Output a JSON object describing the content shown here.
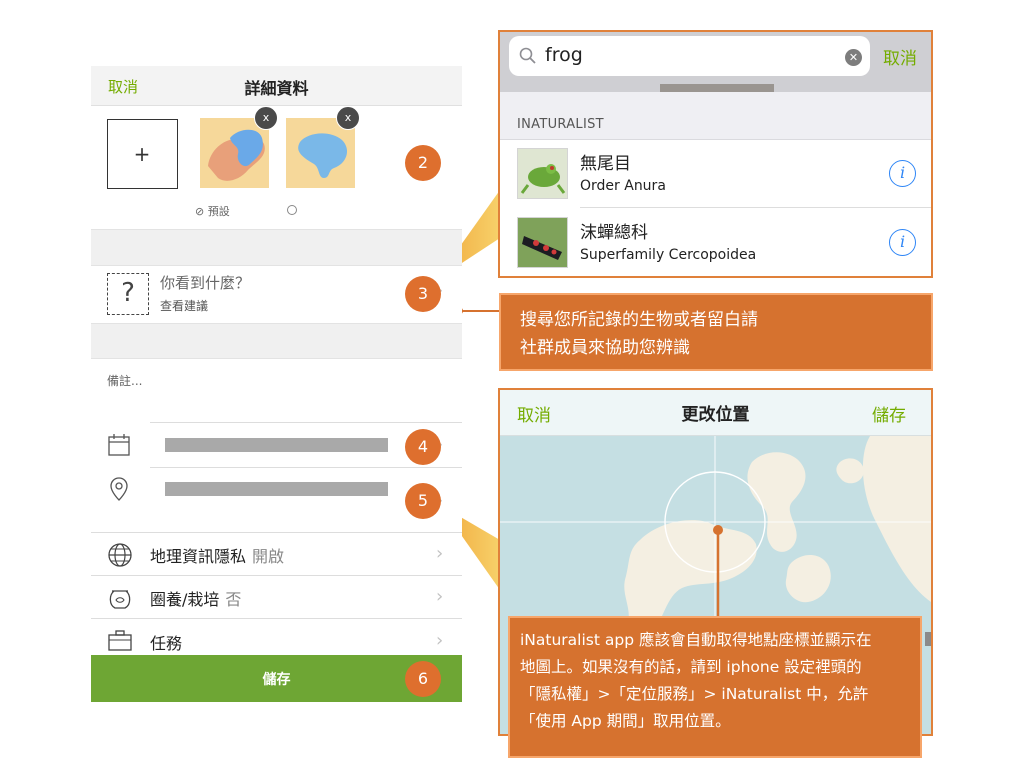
{
  "phone": {
    "header": {
      "cancel": "取消",
      "title": "詳細資料"
    },
    "add_photo": "+",
    "photo_remove": "x",
    "default_label": "⊘ 預設",
    "identify": {
      "title": "你看到什麼？",
      "subtitle": "查看建議",
      "icon": "?"
    },
    "notes_placeholder": "備註...",
    "rows": [
      {
        "label": "地理資訊隱私",
        "value": "開啟",
        "icon": "globe-icon"
      },
      {
        "label": "圈養/栽培",
        "value": "否",
        "icon": "fishbowl-icon"
      },
      {
        "label": "任務",
        "value": "",
        "icon": "briefcase-icon"
      }
    ],
    "save": "儲存"
  },
  "steps": [
    "2",
    "3",
    "4",
    "5",
    "6"
  ],
  "search_panel": {
    "query": "frog",
    "cancel": "取消",
    "section": "INATURALIST",
    "results": [
      {
        "name": "無尾目",
        "scientific": "Order Anura"
      },
      {
        "name": "沫蟬總科",
        "scientific": "Superfamily Cercopoidea"
      }
    ]
  },
  "callout_search": {
    "line1": "搜尋您所記錄的生物或者留白請",
    "line2": "社群成員來協助您辨識"
  },
  "map_panel": {
    "cancel": "取消",
    "title": "更改位置",
    "save": "儲存"
  },
  "callout_location": {
    "line1": "iNaturalist app 應該會自動取得地點座標並顯示在",
    "line2": "地圖上。如果沒有的話，請到 iphone 設定裡頭的",
    "line3": "「隱私權」>「定位服務」> iNaturalist 中，允許",
    "line4": "「使用 App 期間」取用位置。"
  },
  "colors": {
    "accent_green": "#74ac00",
    "save_bar": "#6ea634",
    "callout_orange": "#d6722f",
    "info_blue": "#2f86f6"
  }
}
